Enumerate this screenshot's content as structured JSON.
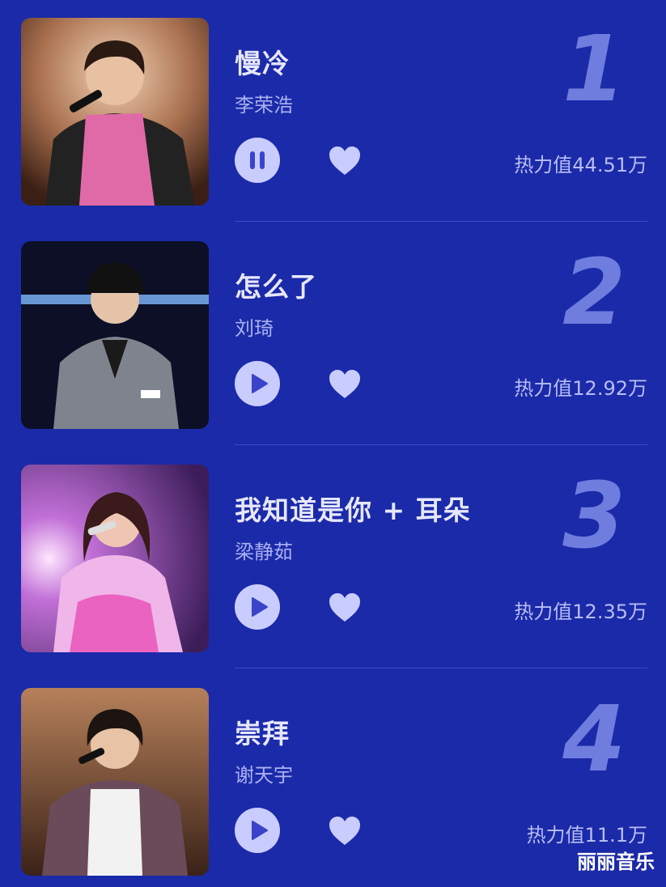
{
  "songs": [
    {
      "rank": "1",
      "title": "慢冷",
      "artist": "李荣浩",
      "heat": "热力值44.51万",
      "state": "playing"
    },
    {
      "rank": "2",
      "title": "怎么了",
      "artist": "刘琦",
      "heat": "热力值12.92万",
      "state": "paused"
    },
    {
      "rank": "3",
      "title": "我知道是你 + 耳朵",
      "artist": "梁静茹",
      "heat": "热力值12.35万",
      "state": "paused"
    },
    {
      "rank": "4",
      "title": "崇拜",
      "artist": "谢天宇",
      "heat": "热力值11.1万",
      "state": "paused"
    }
  ],
  "watermark": "丽丽音乐",
  "icons": {
    "playing": "pause-icon",
    "paused": "play-icon",
    "like": "heart-icon"
  },
  "colors": {
    "background": "#1b2aa8",
    "button": "#c9ccff",
    "rank": "#6f7ddf",
    "accent_icon": "#3a44c9"
  }
}
